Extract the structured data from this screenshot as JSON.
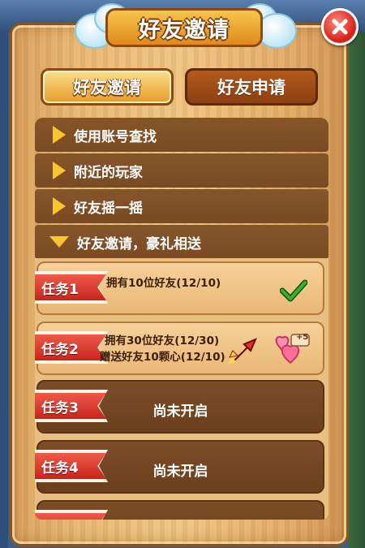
{
  "window": {
    "title": "好友邀请"
  },
  "tabs": [
    {
      "label": "好友邀请",
      "active": true
    },
    {
      "label": "好友申请",
      "active": false
    }
  ],
  "menu": [
    {
      "label": "使用账号查找",
      "arrow": "right"
    },
    {
      "label": "附近的玩家",
      "arrow": "right"
    },
    {
      "label": "好友摇一摇",
      "arrow": "right"
    },
    {
      "label": "好友邀请，豪礼相送",
      "arrow": "down"
    }
  ],
  "tasks": [
    {
      "badge": "任务1",
      "lines": [
        "拥有10位好友(12/10)"
      ],
      "status": "done",
      "reward_icon": "check-icon"
    },
    {
      "badge": "任务2",
      "lines": [
        "拥有30位好友(12/30)",
        "赠送好友10颗心(12/10)"
      ],
      "status": "in-progress",
      "reward_icons": [
        "boost-arrow-icon",
        "hearts-icon"
      ],
      "reward_badge": "+5"
    },
    {
      "badge": "任务3",
      "text": "尚未开启",
      "status": "locked"
    },
    {
      "badge": "任务4",
      "text": "尚未开启",
      "status": "locked"
    },
    {
      "badge": "",
      "text": "",
      "status": "locked"
    }
  ],
  "colors": {
    "panel_wood": "#e8b873",
    "row_brown": "#7a4a22",
    "ribbon_red": "#d8231c",
    "accent_yellow": "#f7c72e",
    "check_green": "#2a8a2a"
  }
}
